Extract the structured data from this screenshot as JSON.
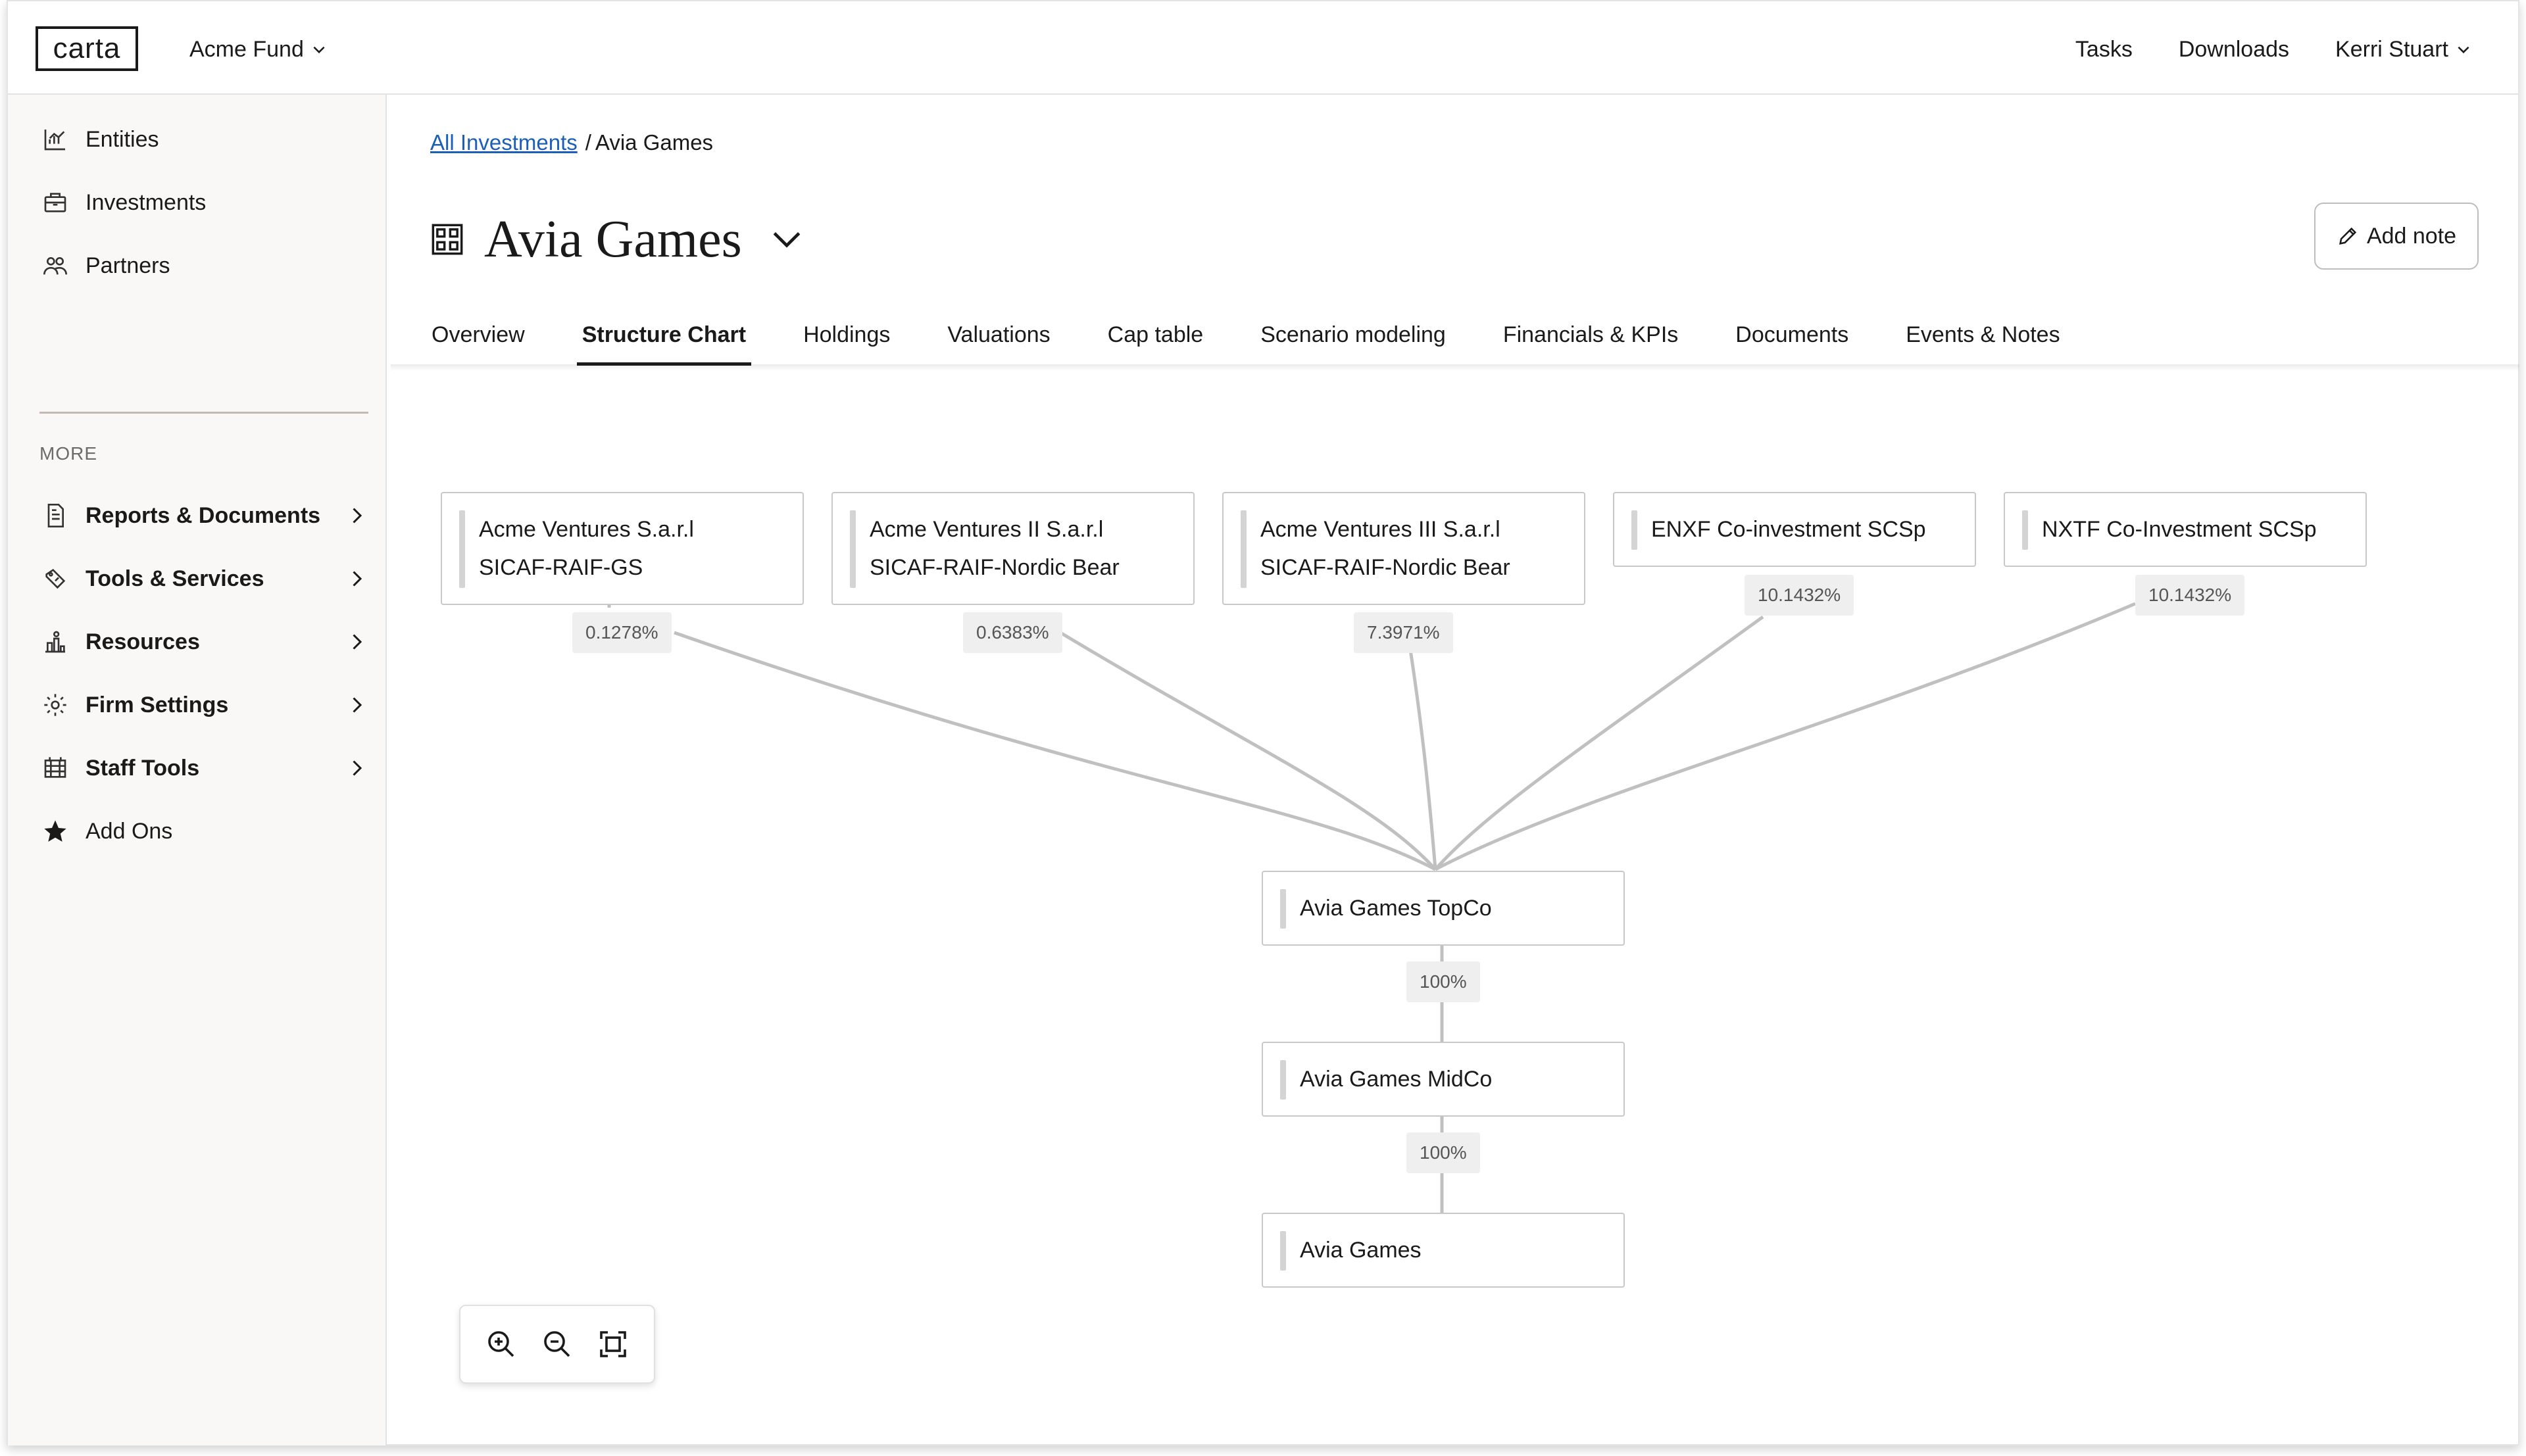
{
  "topbar": {
    "logo": "carta",
    "fund": "Acme Fund",
    "links": [
      "Tasks",
      "Downloads"
    ],
    "user": "Kerri Stuart"
  },
  "sidebar": {
    "items": [
      {
        "label": "Entities",
        "icon": "chart-icon"
      },
      {
        "label": "Investments",
        "icon": "briefcase-icon"
      },
      {
        "label": "Partners",
        "icon": "people-icon"
      }
    ],
    "more_label": "MORE",
    "more_items": [
      {
        "label": "Reports & Documents",
        "icon": "document-icon"
      },
      {
        "label": "Tools & Services",
        "icon": "tools-icon"
      },
      {
        "label": "Resources",
        "icon": "resources-icon"
      },
      {
        "label": "Firm Settings",
        "icon": "gear-icon"
      },
      {
        "label": "Staff Tools",
        "icon": "staff-tools-icon"
      }
    ],
    "addons": {
      "label": "Add Ons",
      "icon": "star-icon"
    }
  },
  "breadcrumb": {
    "link": "All Investments",
    "separator": "/",
    "current": "Avia Games"
  },
  "page": {
    "title": "Avia Games",
    "add_note": "Add note"
  },
  "tabs": [
    "Overview",
    "Structure Chart",
    "Holdings",
    "Valuations",
    "Cap table",
    "Scenario modeling",
    "Financials & KPIs",
    "Documents",
    "Events & Notes"
  ],
  "active_tab": "Structure Chart",
  "structure": {
    "investors": [
      {
        "line1": "Acme Ventures S.a.r.l",
        "line2": "SICAF-RAIF-GS",
        "ownership": "0.1278%"
      },
      {
        "line1": "Acme Ventures II S.a.r.l",
        "line2": "SICAF-RAIF-Nordic Bear",
        "ownership": "0.6383%"
      },
      {
        "line1": "Acme Ventures III S.a.r.l",
        "line2": "SICAF-RAIF-Nordic Bear",
        "ownership": "7.3971%"
      },
      {
        "line1": "ENXF Co-investment SCSp",
        "line2": "",
        "ownership": "10.1432%"
      },
      {
        "line1": "NXTF Co-Investment SCSp",
        "line2": "",
        "ownership": "10.1432%"
      }
    ],
    "chain": [
      {
        "name": "Avia Games TopCo"
      },
      {
        "name": "Avia Games MidCo",
        "ownership_from_parent": "100%"
      },
      {
        "name": "Avia Games",
        "ownership_from_parent": "100%"
      }
    ]
  },
  "colors": {
    "link": "#1c5fb8",
    "line": "#c0c0c0",
    "sidebar_bg": "#faf8f7"
  }
}
